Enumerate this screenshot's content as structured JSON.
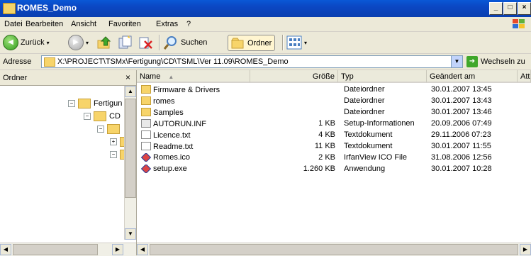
{
  "window": {
    "title": "ROMES_Demo"
  },
  "menu": [
    {
      "label": "Datei"
    },
    {
      "label": "Bearbeiten"
    },
    {
      "label": "Ansicht"
    },
    {
      "label": "Favoriten"
    },
    {
      "label": "Extras"
    },
    {
      "label": "?"
    }
  ],
  "toolbar": {
    "back_label": "Zurück",
    "search_label": "Suchen",
    "folders_label": "Ordner"
  },
  "address": {
    "label": "Adresse",
    "path": "X:\\PROJECT\\TSMx\\Fertigung\\CD\\TSML\\Ver 11.09\\ROMES_Demo",
    "go_label": "Wechseln zu"
  },
  "left_pane": {
    "title": "Ordner",
    "close_glyph": "×",
    "tree": [
      {
        "label": "Fertigun",
        "expander": "−"
      },
      {
        "label": "CD",
        "expander": "−"
      },
      {
        "label": "",
        "expander": "−"
      },
      {
        "label": "",
        "expander": "+"
      },
      {
        "label": "",
        "expander": "−"
      }
    ]
  },
  "columns": [
    {
      "label": "Name",
      "sort": "▲"
    },
    {
      "label": "Größe"
    },
    {
      "label": "Typ"
    },
    {
      "label": "Geändert am"
    },
    {
      "label": "Attr"
    }
  ],
  "files": [
    {
      "icon": "folder-icon",
      "name": "Firmware & Drivers",
      "size": "",
      "type": "Dateiordner",
      "modified": "30.01.2007 13:45"
    },
    {
      "icon": "folder-icon",
      "name": "romes",
      "size": "",
      "type": "Dateiordner",
      "modified": "30.01.2007 13:43"
    },
    {
      "icon": "folder-icon",
      "name": "Samples",
      "size": "",
      "type": "Dateiordner",
      "modified": "30.01.2007 13:46"
    },
    {
      "icon": "setup-info-icon",
      "name": "AUTORUN.INF",
      "size": "1 KB",
      "type": "Setup-Informationen",
      "modified": "20.09.2006 07:49"
    },
    {
      "icon": "text-file-icon",
      "name": "Licence.txt",
      "size": "4 KB",
      "type": "Textdokument",
      "modified": "29.11.2006 07:23"
    },
    {
      "icon": "text-file-icon",
      "name": "Readme.txt",
      "size": "11 KB",
      "type": "Textdokument",
      "modified": "30.01.2007 11:55"
    },
    {
      "icon": "ico-file-icon",
      "name": "Romes.ico",
      "size": "2 KB",
      "type": "IrfanView ICO File",
      "modified": "31.08.2006 12:56"
    },
    {
      "icon": "exe-file-icon",
      "name": "setup.exe",
      "size": "1.260 KB",
      "type": "Anwendung",
      "modified": "30.01.2007 10:28"
    }
  ]
}
